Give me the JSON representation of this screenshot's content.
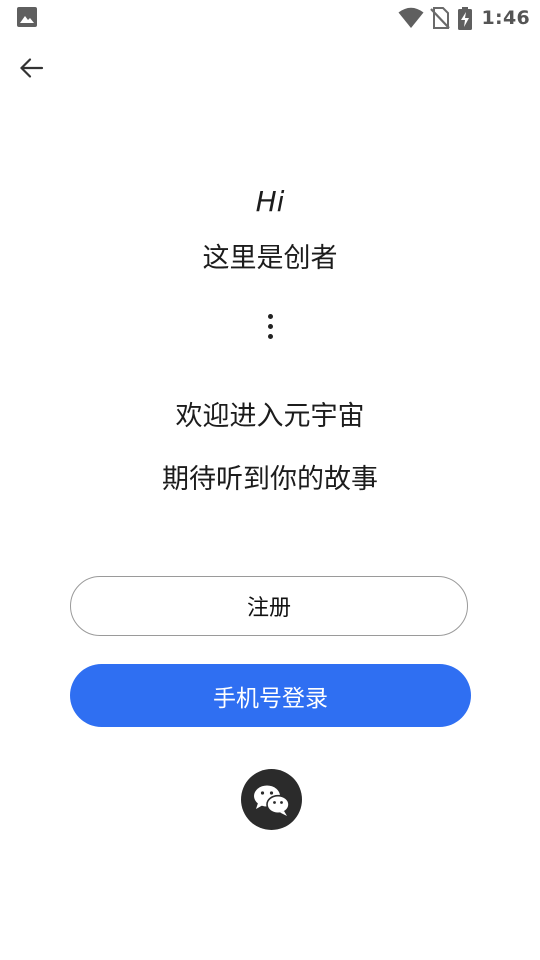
{
  "status_bar": {
    "time": "1:46",
    "icons": [
      "gallery-icon",
      "wifi-icon",
      "no-sim-icon",
      "battery-charging-icon"
    ]
  },
  "nav": {
    "back_icon": "back-arrow-icon"
  },
  "greeting": {
    "hi": "Hi",
    "intro": "这里是创者",
    "separator_icon": "vertical-dots-icon",
    "welcome": "欢迎进入元宇宙",
    "story": "期待听到你的故事"
  },
  "actions": {
    "register_label": "注册",
    "phone_login_label": "手机号登录",
    "wechat_icon": "wechat-icon"
  },
  "colors": {
    "primary": "#2f6ff2",
    "wechat_bg": "#2b2b2b",
    "register_border": "#9a9a9a"
  }
}
